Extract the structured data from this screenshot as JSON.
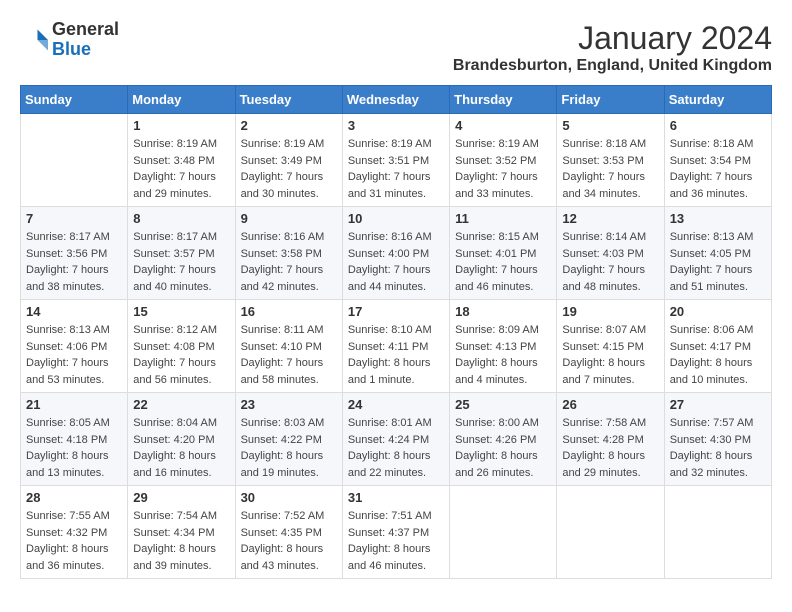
{
  "logo": {
    "general": "General",
    "blue": "Blue"
  },
  "title": "January 2024",
  "location": "Brandesburton, England, United Kingdom",
  "days_header": [
    "Sunday",
    "Monday",
    "Tuesday",
    "Wednesday",
    "Thursday",
    "Friday",
    "Saturday"
  ],
  "weeks": [
    [
      {
        "day": "",
        "info": ""
      },
      {
        "day": "1",
        "info": "Sunrise: 8:19 AM\nSunset: 3:48 PM\nDaylight: 7 hours\nand 29 minutes."
      },
      {
        "day": "2",
        "info": "Sunrise: 8:19 AM\nSunset: 3:49 PM\nDaylight: 7 hours\nand 30 minutes."
      },
      {
        "day": "3",
        "info": "Sunrise: 8:19 AM\nSunset: 3:51 PM\nDaylight: 7 hours\nand 31 minutes."
      },
      {
        "day": "4",
        "info": "Sunrise: 8:19 AM\nSunset: 3:52 PM\nDaylight: 7 hours\nand 33 minutes."
      },
      {
        "day": "5",
        "info": "Sunrise: 8:18 AM\nSunset: 3:53 PM\nDaylight: 7 hours\nand 34 minutes."
      },
      {
        "day": "6",
        "info": "Sunrise: 8:18 AM\nSunset: 3:54 PM\nDaylight: 7 hours\nand 36 minutes."
      }
    ],
    [
      {
        "day": "7",
        "info": "Sunrise: 8:17 AM\nSunset: 3:56 PM\nDaylight: 7 hours\nand 38 minutes."
      },
      {
        "day": "8",
        "info": "Sunrise: 8:17 AM\nSunset: 3:57 PM\nDaylight: 7 hours\nand 40 minutes."
      },
      {
        "day": "9",
        "info": "Sunrise: 8:16 AM\nSunset: 3:58 PM\nDaylight: 7 hours\nand 42 minutes."
      },
      {
        "day": "10",
        "info": "Sunrise: 8:16 AM\nSunset: 4:00 PM\nDaylight: 7 hours\nand 44 minutes."
      },
      {
        "day": "11",
        "info": "Sunrise: 8:15 AM\nSunset: 4:01 PM\nDaylight: 7 hours\nand 46 minutes."
      },
      {
        "day": "12",
        "info": "Sunrise: 8:14 AM\nSunset: 4:03 PM\nDaylight: 7 hours\nand 48 minutes."
      },
      {
        "day": "13",
        "info": "Sunrise: 8:13 AM\nSunset: 4:05 PM\nDaylight: 7 hours\nand 51 minutes."
      }
    ],
    [
      {
        "day": "14",
        "info": "Sunrise: 8:13 AM\nSunset: 4:06 PM\nDaylight: 7 hours\nand 53 minutes."
      },
      {
        "day": "15",
        "info": "Sunrise: 8:12 AM\nSunset: 4:08 PM\nDaylight: 7 hours\nand 56 minutes."
      },
      {
        "day": "16",
        "info": "Sunrise: 8:11 AM\nSunset: 4:10 PM\nDaylight: 7 hours\nand 58 minutes."
      },
      {
        "day": "17",
        "info": "Sunrise: 8:10 AM\nSunset: 4:11 PM\nDaylight: 8 hours\nand 1 minute."
      },
      {
        "day": "18",
        "info": "Sunrise: 8:09 AM\nSunset: 4:13 PM\nDaylight: 8 hours\nand 4 minutes."
      },
      {
        "day": "19",
        "info": "Sunrise: 8:07 AM\nSunset: 4:15 PM\nDaylight: 8 hours\nand 7 minutes."
      },
      {
        "day": "20",
        "info": "Sunrise: 8:06 AM\nSunset: 4:17 PM\nDaylight: 8 hours\nand 10 minutes."
      }
    ],
    [
      {
        "day": "21",
        "info": "Sunrise: 8:05 AM\nSunset: 4:18 PM\nDaylight: 8 hours\nand 13 minutes."
      },
      {
        "day": "22",
        "info": "Sunrise: 8:04 AM\nSunset: 4:20 PM\nDaylight: 8 hours\nand 16 minutes."
      },
      {
        "day": "23",
        "info": "Sunrise: 8:03 AM\nSunset: 4:22 PM\nDaylight: 8 hours\nand 19 minutes."
      },
      {
        "day": "24",
        "info": "Sunrise: 8:01 AM\nSunset: 4:24 PM\nDaylight: 8 hours\nand 22 minutes."
      },
      {
        "day": "25",
        "info": "Sunrise: 8:00 AM\nSunset: 4:26 PM\nDaylight: 8 hours\nand 26 minutes."
      },
      {
        "day": "26",
        "info": "Sunrise: 7:58 AM\nSunset: 4:28 PM\nDaylight: 8 hours\nand 29 minutes."
      },
      {
        "day": "27",
        "info": "Sunrise: 7:57 AM\nSunset: 4:30 PM\nDaylight: 8 hours\nand 32 minutes."
      }
    ],
    [
      {
        "day": "28",
        "info": "Sunrise: 7:55 AM\nSunset: 4:32 PM\nDaylight: 8 hours\nand 36 minutes."
      },
      {
        "day": "29",
        "info": "Sunrise: 7:54 AM\nSunset: 4:34 PM\nDaylight: 8 hours\nand 39 minutes."
      },
      {
        "day": "30",
        "info": "Sunrise: 7:52 AM\nSunset: 4:35 PM\nDaylight: 8 hours\nand 43 minutes."
      },
      {
        "day": "31",
        "info": "Sunrise: 7:51 AM\nSunset: 4:37 PM\nDaylight: 8 hours\nand 46 minutes."
      },
      {
        "day": "",
        "info": ""
      },
      {
        "day": "",
        "info": ""
      },
      {
        "day": "",
        "info": ""
      }
    ]
  ]
}
